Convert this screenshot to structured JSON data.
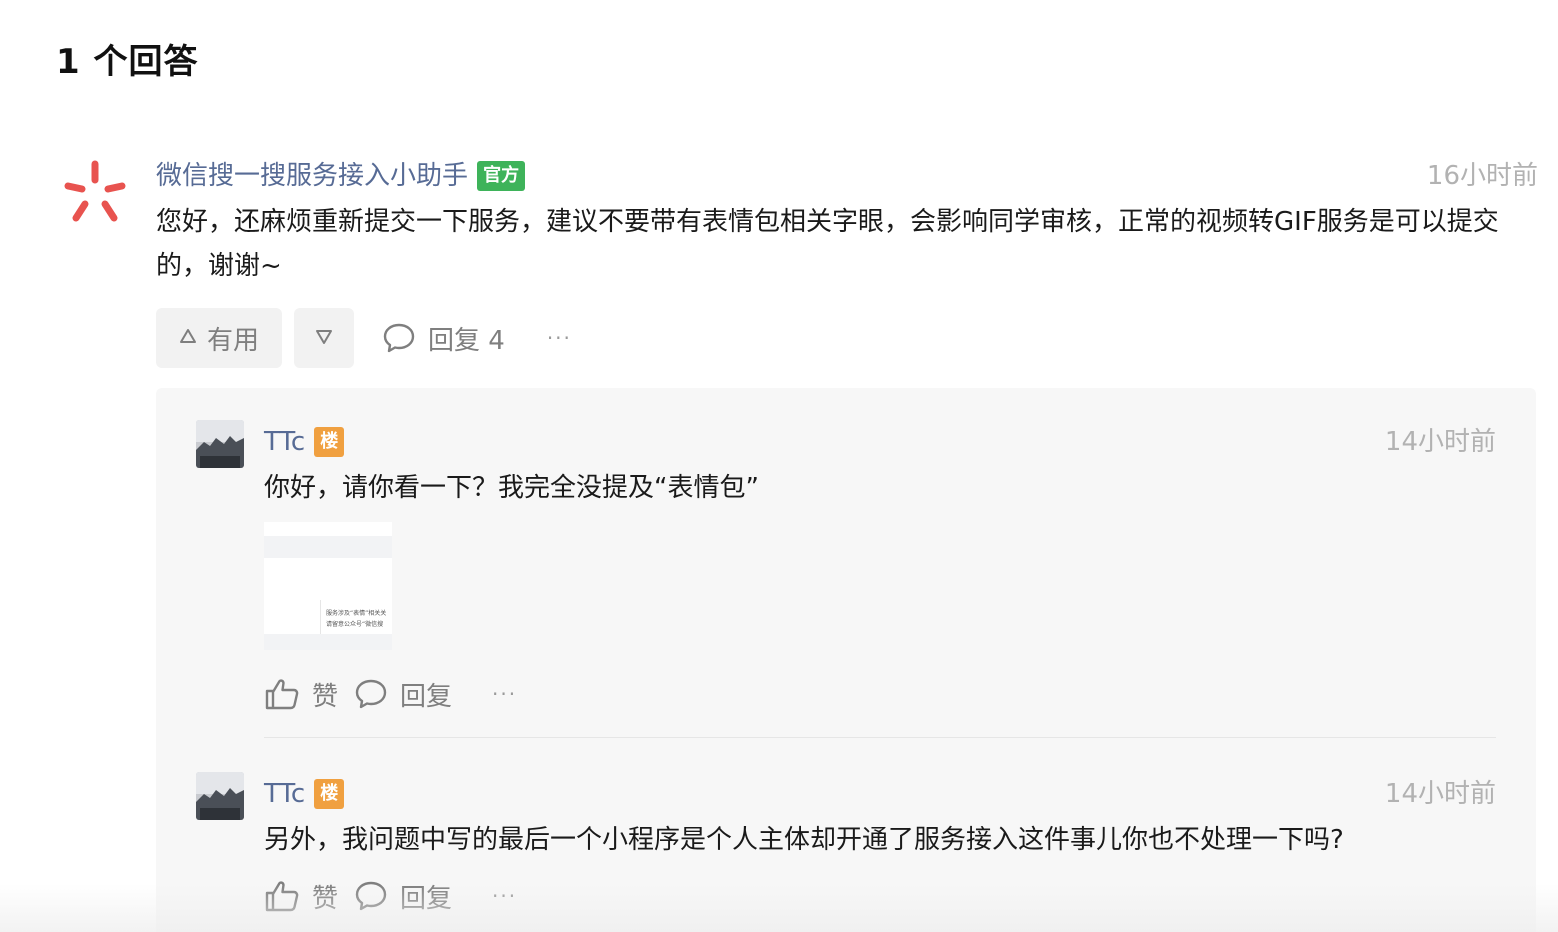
{
  "answers_header": "1 个回答",
  "answer": {
    "author": "微信搜一搜服务接入小助手",
    "badge": "官方",
    "time": "16小时前",
    "text": "您好，还麻烦重新提交一下服务，建议不要带有表情包相关字眼，会影响同学审核，正常的视频转GIF服务是可以提交的，谢谢~",
    "useful_label": "有用",
    "reply_label": "回复 4",
    "more": "···"
  },
  "replies": [
    {
      "author": "TTc",
      "badge": "楼",
      "time": "14小时前",
      "text": "你好，请你看一下？我完全没提及“表情包”",
      "image_lines": [
        "服务涉及“表情”相关关",
        "请留意公众号“微信搜"
      ],
      "like_label": "赞",
      "reply_label": "回复",
      "more": "···"
    },
    {
      "author": "TTc",
      "badge": "楼",
      "time": "14小时前",
      "text": "另外，我问题中写的最后一个小程序是个人主体却开通了服务接入这件事儿你也不处理一下吗?",
      "like_label": "赞",
      "reply_label": "回复",
      "more": "···"
    }
  ],
  "colors": {
    "author_link": "#576b95",
    "official_badge": "#3eb35a",
    "floor_badge": "#f0a040",
    "logo": "#e8534f"
  },
  "icons": [
    "wechat-search-logo-icon",
    "thumb-up-icon",
    "comment-bubble-icon",
    "triangle-up-icon",
    "triangle-down-icon",
    "more-dots-icon"
  ]
}
